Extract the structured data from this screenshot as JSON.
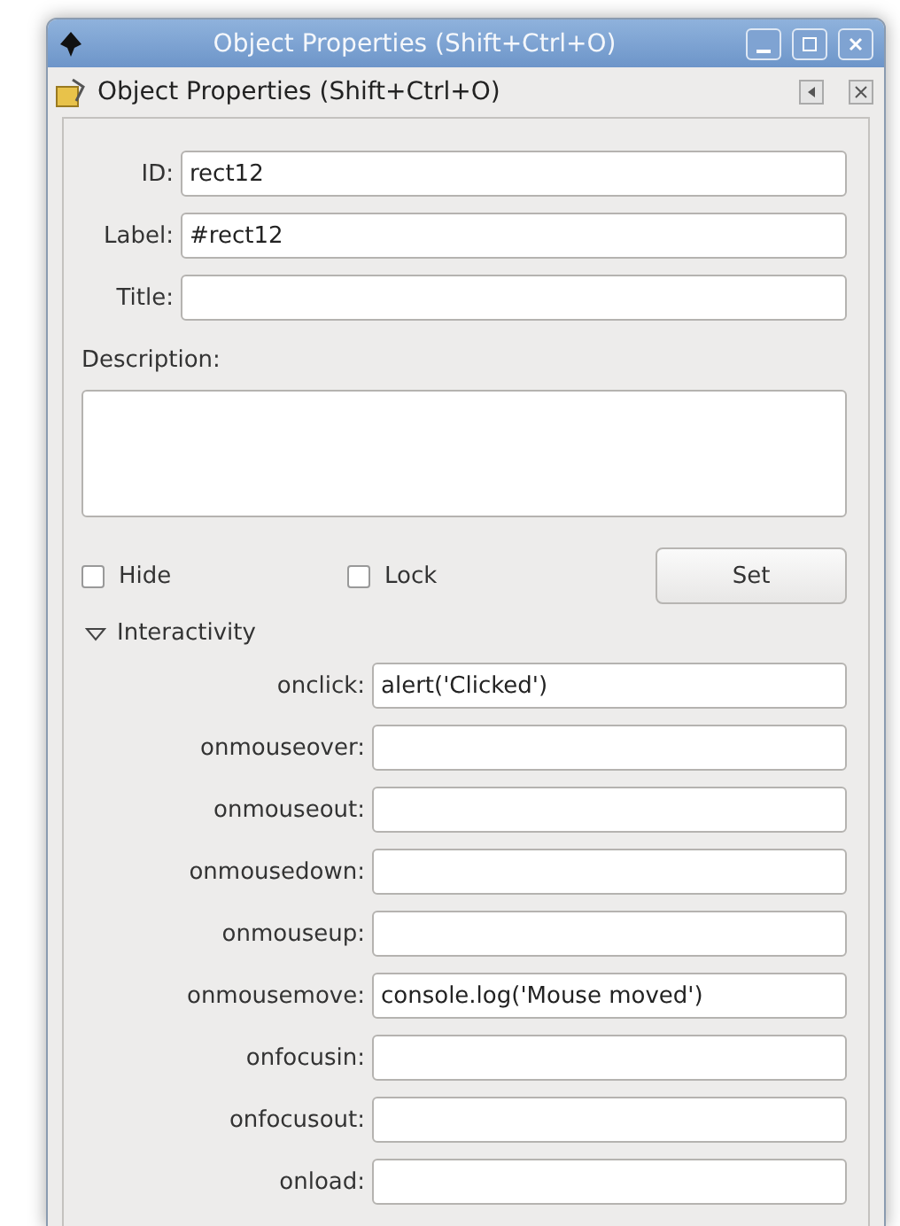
{
  "window": {
    "title": "Object Properties (Shift+Ctrl+O)"
  },
  "panel": {
    "title": "Object Properties (Shift+Ctrl+O)"
  },
  "fields": [
    {
      "label": "ID:",
      "value": "rect12"
    },
    {
      "label": "Label:",
      "value": "#rect12"
    },
    {
      "label": "Title:"
    }
  ],
  "description": {
    "label": "Description:"
  },
  "checkboxes": [
    {
      "label": "Hide",
      "checked": false
    },
    {
      "label": "Lock",
      "checked": false
    }
  ],
  "set_button": "Set",
  "interactivity": {
    "label": "Interactivity",
    "expanded": true,
    "events": [
      {
        "label": "onclick:",
        "value": "alert('Clicked')"
      },
      {
        "label": "onmouseover:"
      },
      {
        "label": "onmouseout:"
      },
      {
        "label": "onmousedown:"
      },
      {
        "label": "onmouseup:"
      },
      {
        "label": "onmousemove:",
        "value": "console.log('Mouse moved')"
      },
      {
        "label": "onfocusin:"
      },
      {
        "label": "onfocusout:"
      },
      {
        "label": "onload:"
      }
    ]
  }
}
